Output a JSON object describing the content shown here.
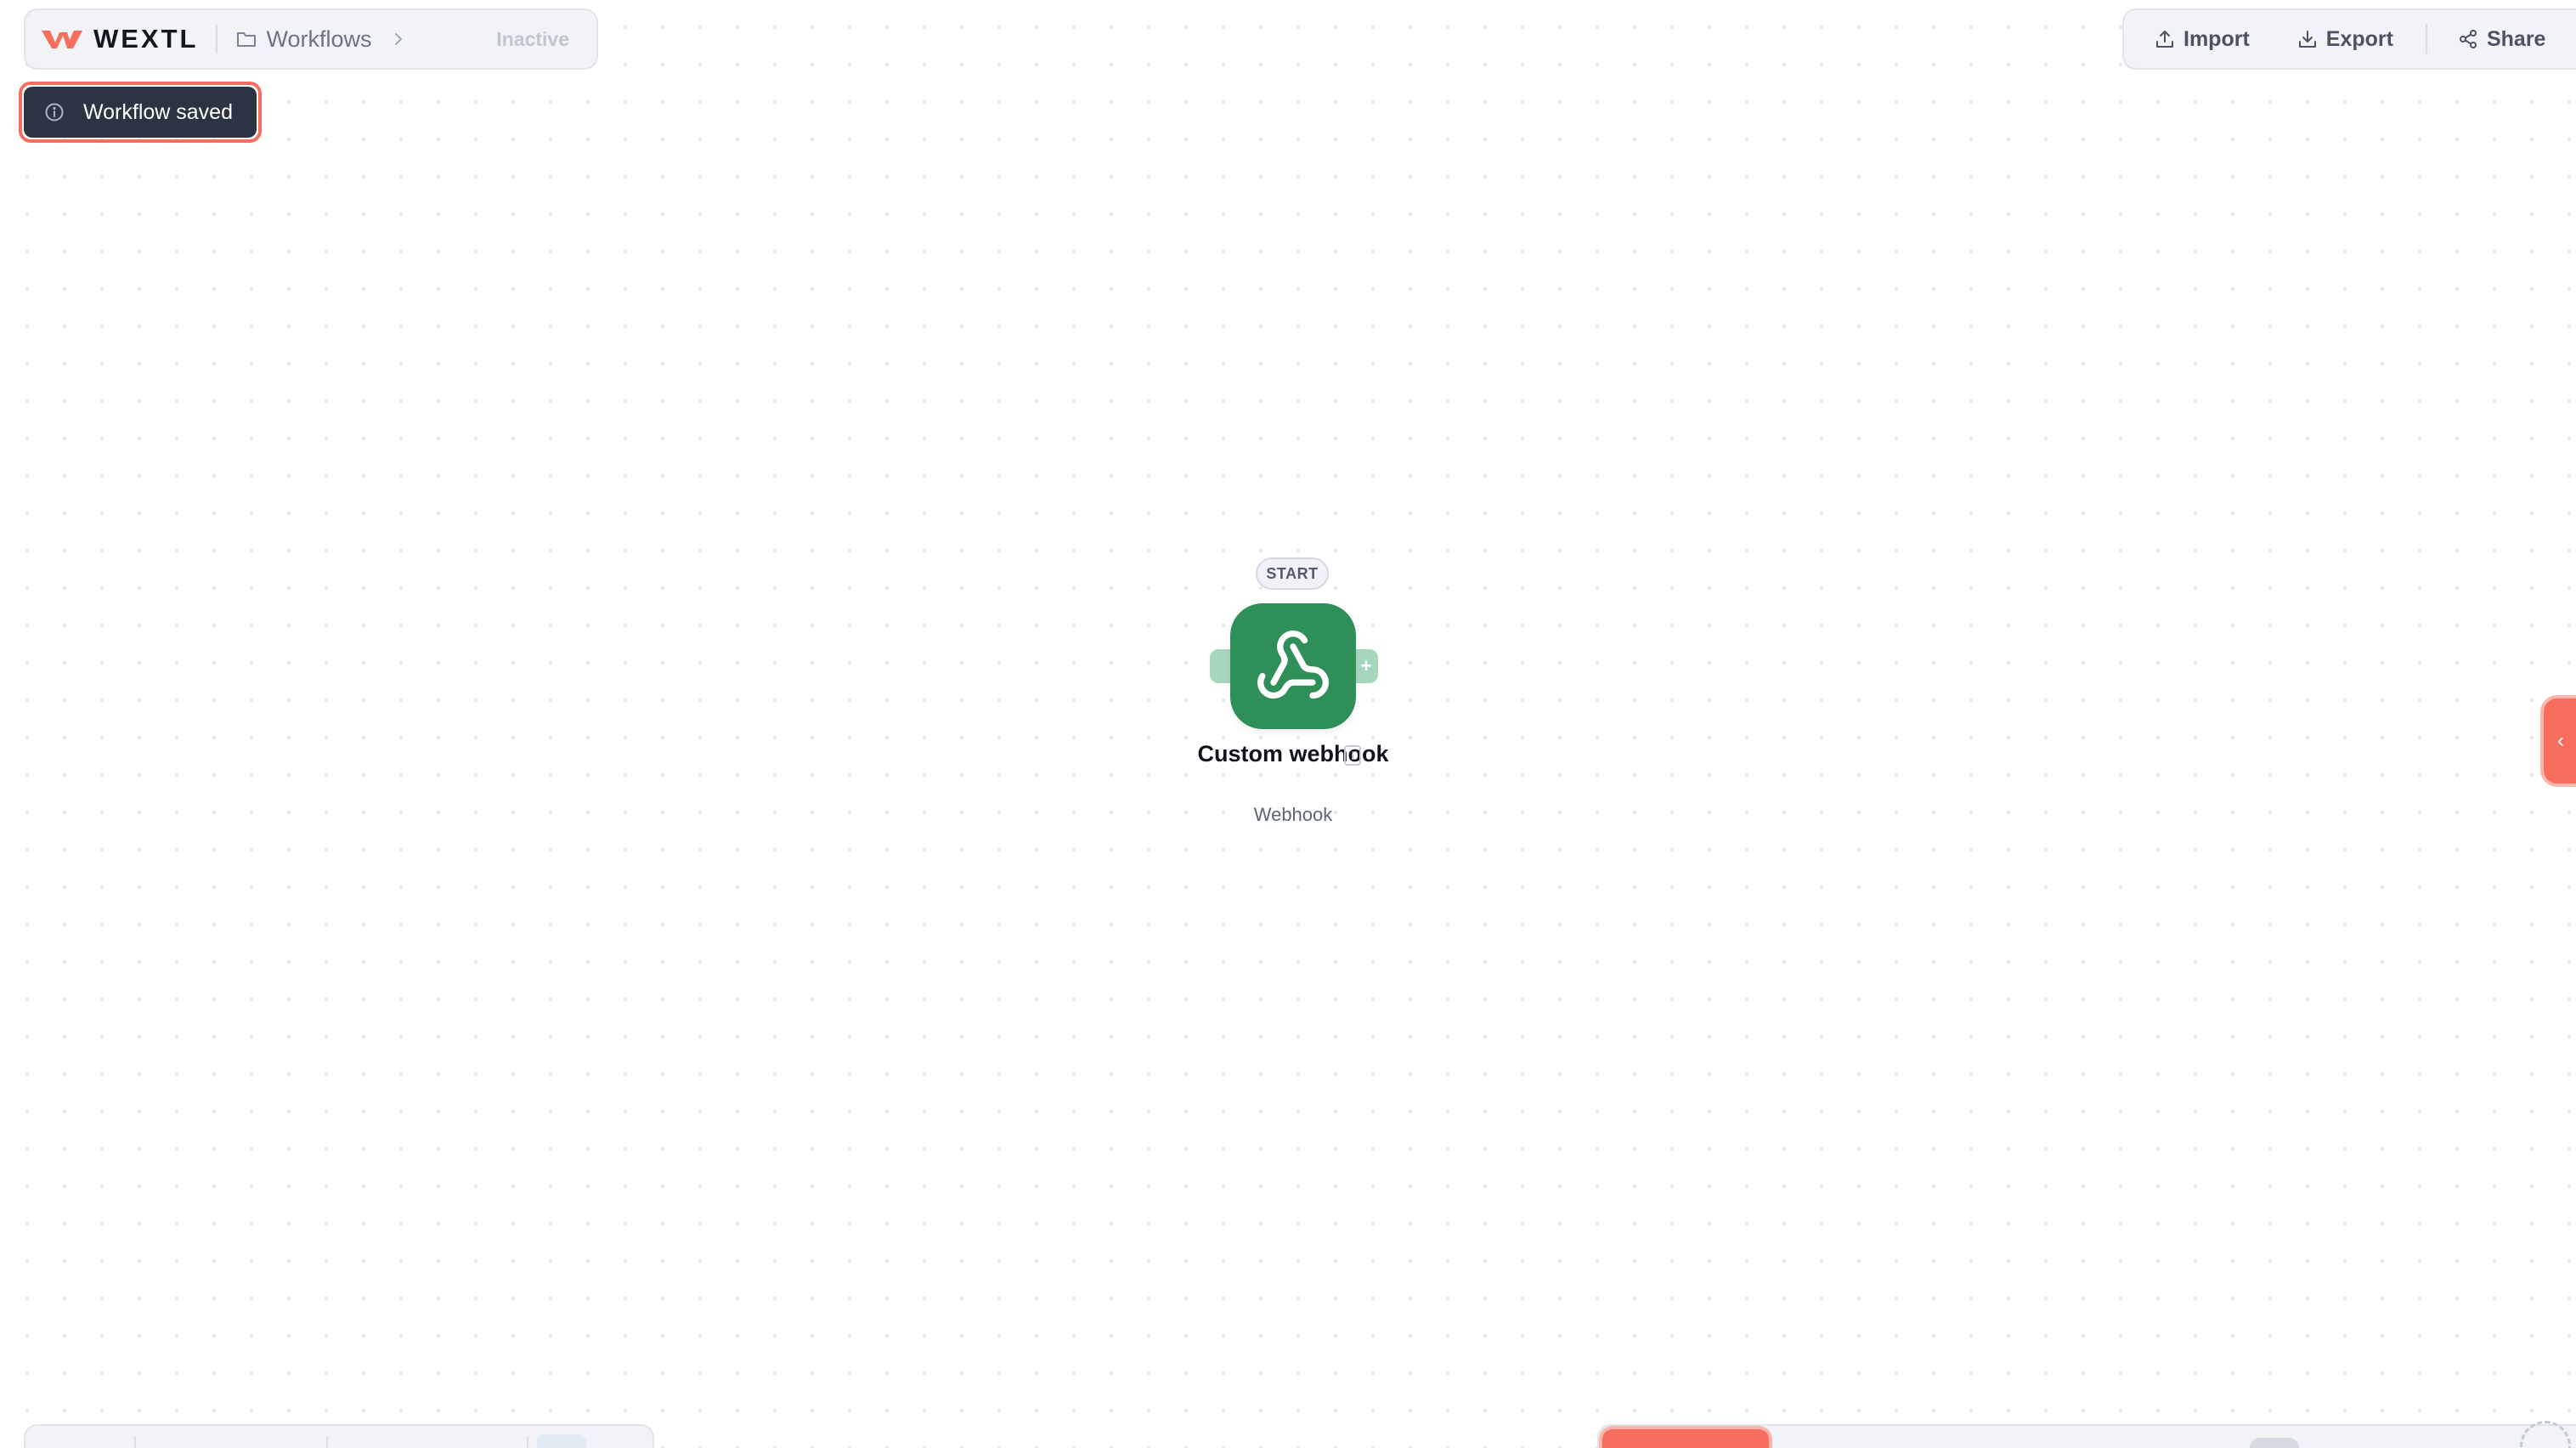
{
  "app": {
    "brand": "WEXTL",
    "brand_color": "#f76d5e"
  },
  "breadcrumb": {
    "section": "Workflows",
    "folder_icon": "folder-icon",
    "separator_icon": "chevron-right-icon",
    "status": "Inactive"
  },
  "actions": {
    "import_label": "Import",
    "export_label": "Export",
    "share_label": "Share"
  },
  "toast": {
    "message": "Workflow saved",
    "icon": "info-icon"
  },
  "node": {
    "badge": "START",
    "title": "Custom webhook",
    "subtitle": "Webhook",
    "icon": "webhook-icon",
    "color": "#2f8f58",
    "add_handle_symbol": "+"
  },
  "side_tab": {
    "icon_symbol": "‹"
  }
}
